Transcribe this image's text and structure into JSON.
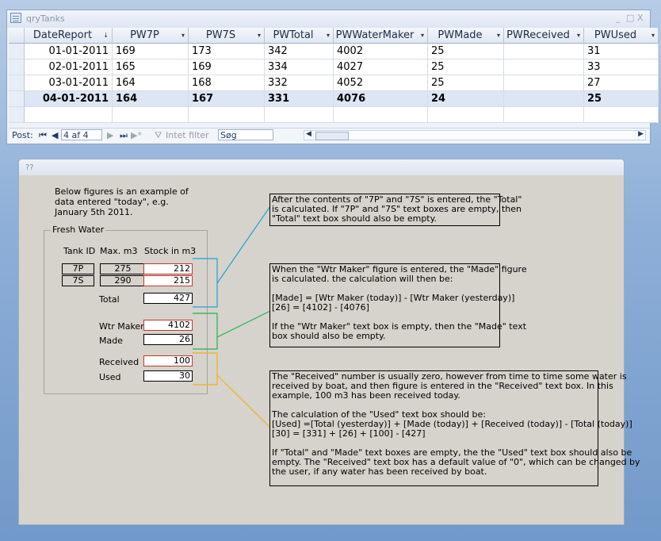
{
  "query": {
    "title": "qryTanks",
    "window_controls": [
      "_",
      "□",
      "X"
    ],
    "columns": [
      {
        "label": "DateReport",
        "arrow": "↓"
      },
      {
        "label": "PW7P",
        "arrow": "▾"
      },
      {
        "label": "PW7S",
        "arrow": "▾"
      },
      {
        "label": "PWTotal",
        "arrow": "▾"
      },
      {
        "label": "PWWaterMaker",
        "arrow": "▾"
      },
      {
        "label": "PWMade",
        "arrow": "▾"
      },
      {
        "label": "PWReceived",
        "arrow": "▾"
      },
      {
        "label": "PWUsed",
        "arrow": "▾"
      }
    ],
    "rows": [
      [
        "01-01-2011",
        "169",
        "173",
        "342",
        "4002",
        "25",
        "",
        "31"
      ],
      [
        "02-01-2011",
        "165",
        "169",
        "334",
        "4027",
        "25",
        "",
        "33"
      ],
      [
        "03-01-2011",
        "164",
        "168",
        "332",
        "4052",
        "25",
        "",
        "27"
      ],
      [
        "04-01-2011",
        "164",
        "167",
        "331",
        "4076",
        "24",
        "",
        "25"
      ]
    ],
    "nav": {
      "label": "Post:",
      "first": "⏮",
      "prev": "◀",
      "record": "4 af 4",
      "next": "▶",
      "last": "⏭",
      "new": "▶*",
      "filter": "Intet filter",
      "search": "Søg"
    }
  },
  "form": {
    "title": "??",
    "intro": "Below figures is an example of\ndata entered \"today\", e.g.\nJanuary 5th 2011.",
    "group_label": "Fresh Water",
    "col_tank": "Tank ID",
    "col_max": "Max. m3",
    "col_stock": "Stock in m3",
    "tanks": [
      {
        "id": "7P",
        "max": "275",
        "stock": "212"
      },
      {
        "id": "7S",
        "max": "290",
        "stock": "215"
      }
    ],
    "total_label": "Total",
    "total_value": "427",
    "wtr_label": "Wtr Maker",
    "wtr_value": "4102",
    "made_label": "Made",
    "made_value": "26",
    "received_label": "Received",
    "received_value": "100",
    "used_label": "Used",
    "used_value": "30",
    "note1": "After the contents of \"7P\" and \"7S\" is entered, the \"Total\"\nis calculated. If \"7P\" and \"7S\" text boxes are empty, then\n\"Total\" text box should also be empty.",
    "note2": "When the \"Wtr Maker\" figure is entered, the \"Made\" figure\nis calculated. the calculation will then be:\n\n[Made] = [Wtr Maker (today)] - [Wtr Maker (yesterday)]\n[26] = [4102] - [4076]\n\nIf the \"Wtr Maker\" text box is empty, then the \"Made\" text\nbox should also be empty.",
    "note3": "The \"Received\" number is usually zero, however from time to time some water is\nreceived by boat, and then figure is entered in the \"Received\" text box. In this\nexample, 100 m3 has been received today.\n\nThe calculation of the \"Used\" text box should be:\n[Used] =[Total (yesterday)] + [Made (today)] + [Received (today)] - [Total (today)]\n[30] = [331] + [26] + [100] - [427]\n\nIf \"Total\" and \"Made\" text boxes are empty, the the \"Used\" text box should also be\nempty. The \"Received\" text box has a default value of \"0\", which can be changed by\nthe user, if any water has been received by boat.",
    "connector_colors": {
      "total": "#1fa3d6",
      "made": "#22b24c",
      "used": "#f0b21f"
    }
  }
}
